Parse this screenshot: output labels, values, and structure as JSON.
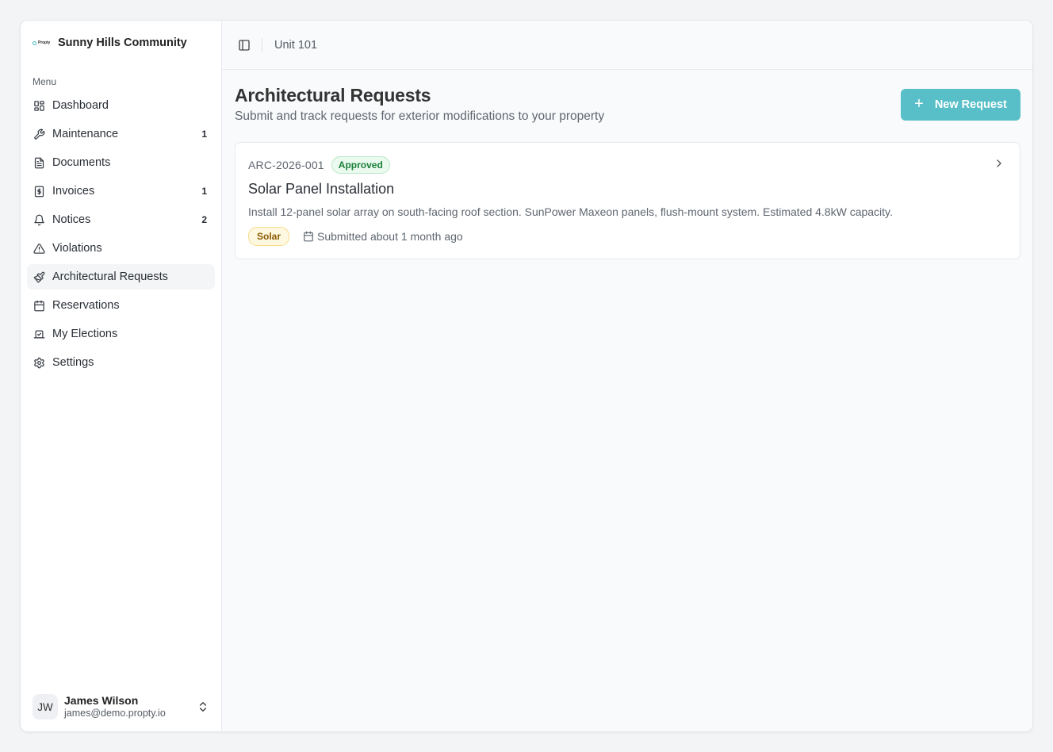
{
  "sidebar": {
    "brand_logo_text": "Propty",
    "community": "Sunny Hills Community",
    "menu_label": "Menu",
    "items": [
      {
        "label": "Dashboard",
        "icon": "dashboard-icon",
        "badge": ""
      },
      {
        "label": "Maintenance",
        "icon": "wrench-icon",
        "badge": "1"
      },
      {
        "label": "Documents",
        "icon": "document-icon",
        "badge": ""
      },
      {
        "label": "Invoices",
        "icon": "invoice-icon",
        "badge": "1"
      },
      {
        "label": "Notices",
        "icon": "bell-icon",
        "badge": "2"
      },
      {
        "label": "Violations",
        "icon": "warning-icon",
        "badge": ""
      },
      {
        "label": "Architectural Requests",
        "icon": "paintbrush-icon",
        "badge": ""
      },
      {
        "label": "Reservations",
        "icon": "calendar-icon",
        "badge": ""
      },
      {
        "label": "My Elections",
        "icon": "ballot-icon",
        "badge": ""
      },
      {
        "label": "Settings",
        "icon": "gear-icon",
        "badge": ""
      }
    ],
    "active_item": "Architectural Requests",
    "user": {
      "initials": "JW",
      "name": "James Wilson",
      "email": "james@demo.propty.io"
    }
  },
  "topbar": {
    "breadcrumb": "Unit 101"
  },
  "page": {
    "title": "Architectural Requests",
    "subtitle": "Submit and track requests for exterior modifications to your property",
    "new_button_label": "New Request"
  },
  "requests": [
    {
      "id": "ARC-2026-001",
      "status": "Approved",
      "title": "Solar Panel Installation",
      "description": "Install 12-panel solar array on south-facing roof section. SunPower Maxeon panels, flush-mount system. Estimated 4.8kW capacity.",
      "category": "Solar",
      "submitted": "Submitted about 1 month ago"
    }
  ],
  "colors": {
    "accent": "#58bfc8",
    "approved_text": "#1a7f37",
    "approved_bg": "#ebfaef",
    "tag_text": "#8a5a00",
    "tag_bg": "#fff8e1"
  }
}
